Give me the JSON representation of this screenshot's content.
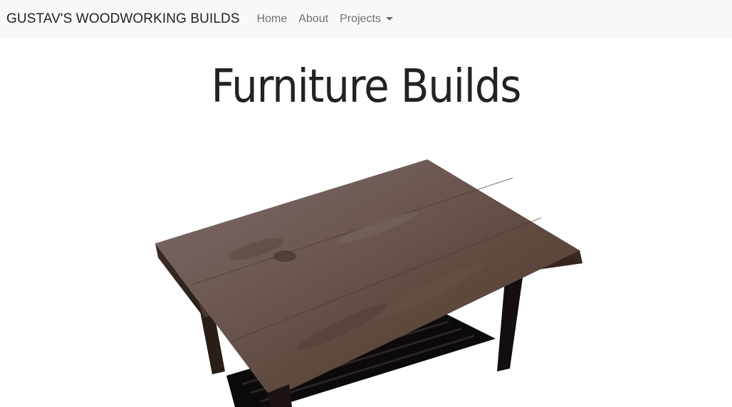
{
  "navbar": {
    "brand": "GUSTAV'S WOODWORKING BUILDS",
    "links": [
      {
        "label": "Home"
      },
      {
        "label": "About"
      }
    ],
    "dropdown": {
      "label": "Projects",
      "icon": "caret-down-icon"
    }
  },
  "main": {
    "title": "Furniture Builds",
    "image": {
      "subject": "walnut-coffee-table"
    }
  },
  "colors": {
    "navbar_bg": "#f8f8f8",
    "brand_text": "#222222",
    "nav_text": "#6f6f6f",
    "page_bg": "#ffffff"
  }
}
